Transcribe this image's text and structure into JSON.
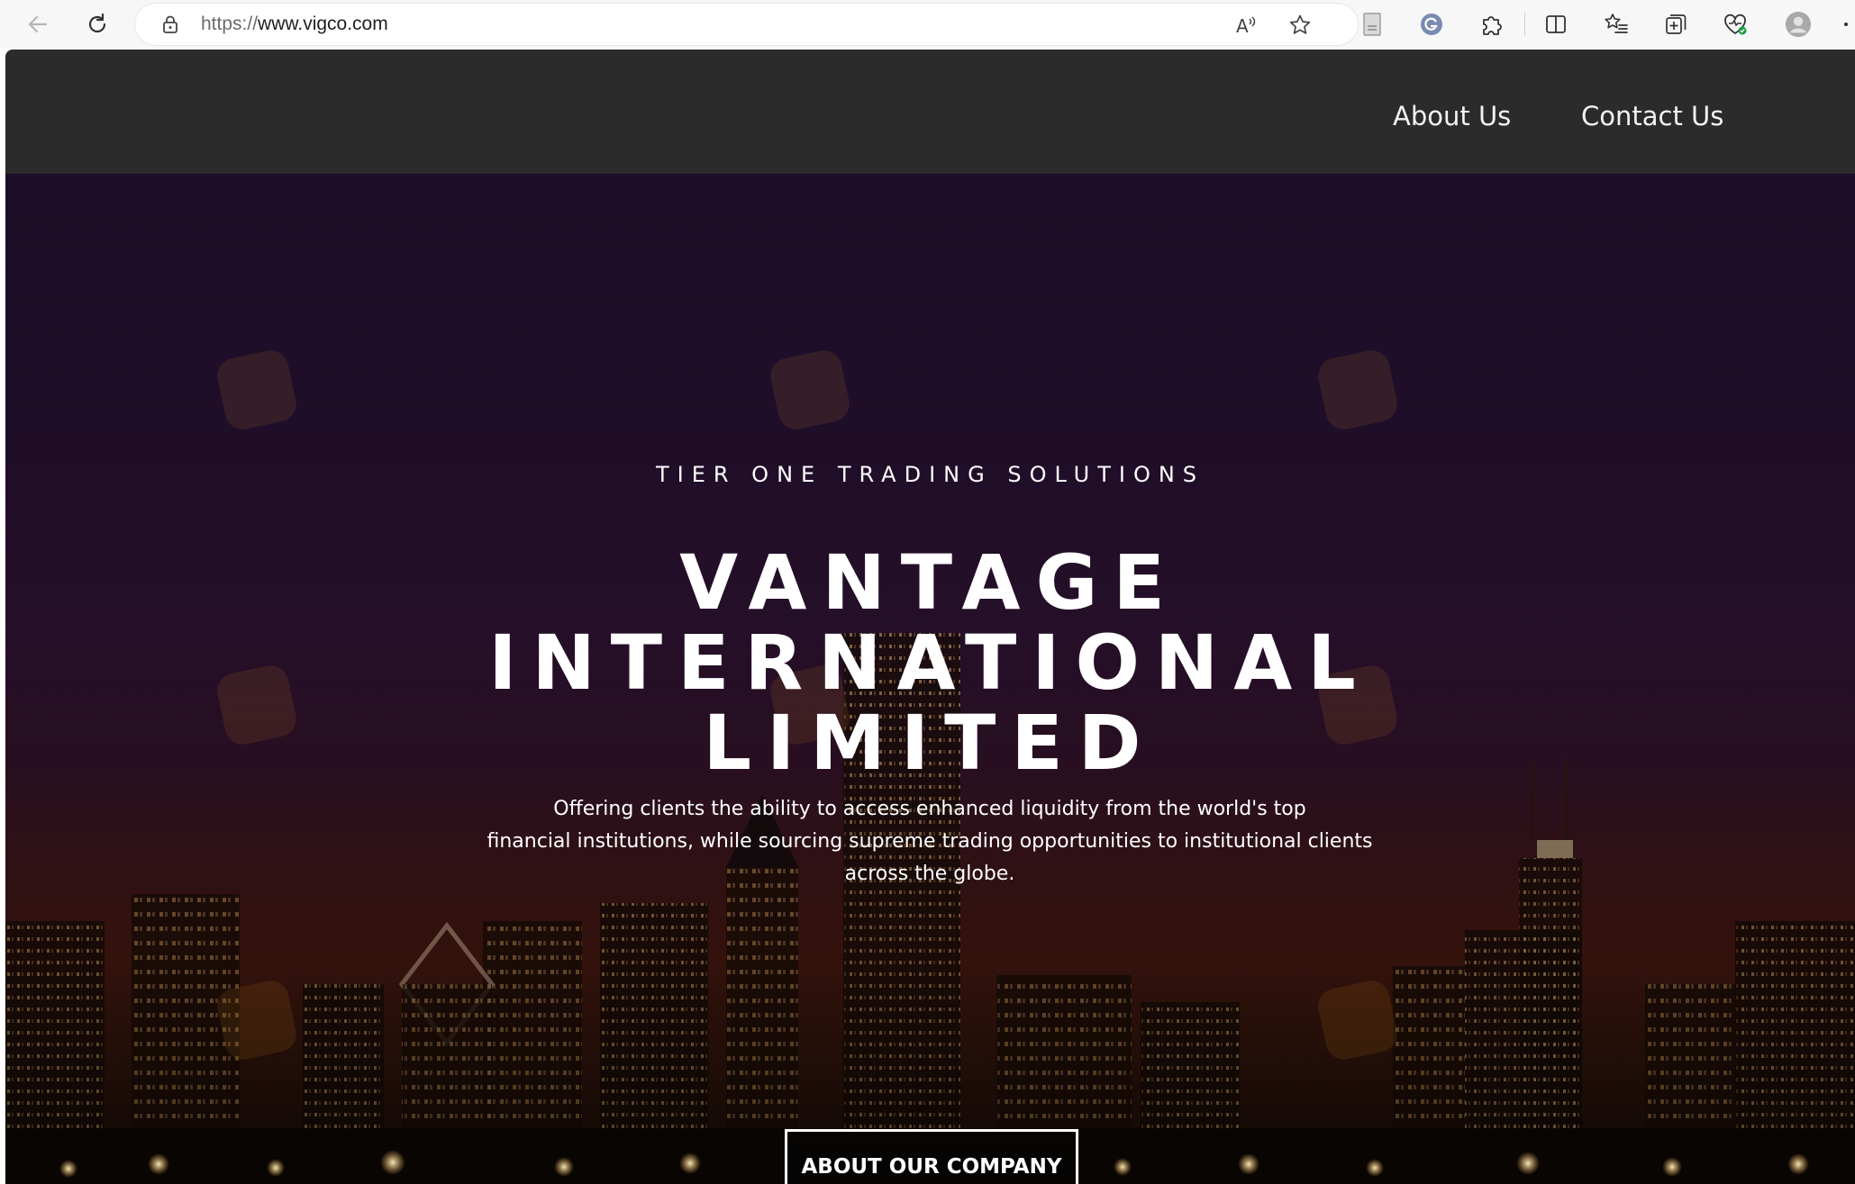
{
  "browser": {
    "url_scheme": "https://",
    "url_host": "www.vigco.com",
    "icons": {
      "back": "back-arrow-icon",
      "reload": "reload-icon",
      "lock": "lock-icon",
      "read_aloud": "read-aloud-icon",
      "favorite": "star-icon",
      "extensions": "puzzle-icon",
      "split": "split-screen-icon",
      "favorites": "favorites-list-icon",
      "collections": "collections-icon",
      "health": "browser-essentials-icon",
      "profile": "profile-avatar-icon"
    },
    "reader_icon_text": "A",
    "reader_icon_sup": "))"
  },
  "header": {
    "nav": [
      {
        "label": "About Us"
      },
      {
        "label": "Contact Us"
      }
    ]
  },
  "hero": {
    "tagline": "TIER ONE TRADING SOLUTIONS",
    "title_lines": [
      "VANTAGE",
      "INTERNATIONAL",
      "LIMITED"
    ],
    "description_lines": [
      "Offering clients the ability to access enhanced liquidity from the world's top",
      "financial institutions, while sourcing supreme trading opportunities to institutional clients",
      "across the globe."
    ],
    "cta_label": "ABOUT OUR COMPANY"
  },
  "colors": {
    "header_bg": "#2b2b2b",
    "hero_top": "#1c0d28",
    "hero_bottom": "#5a1f14",
    "text": "#ffffff"
  }
}
